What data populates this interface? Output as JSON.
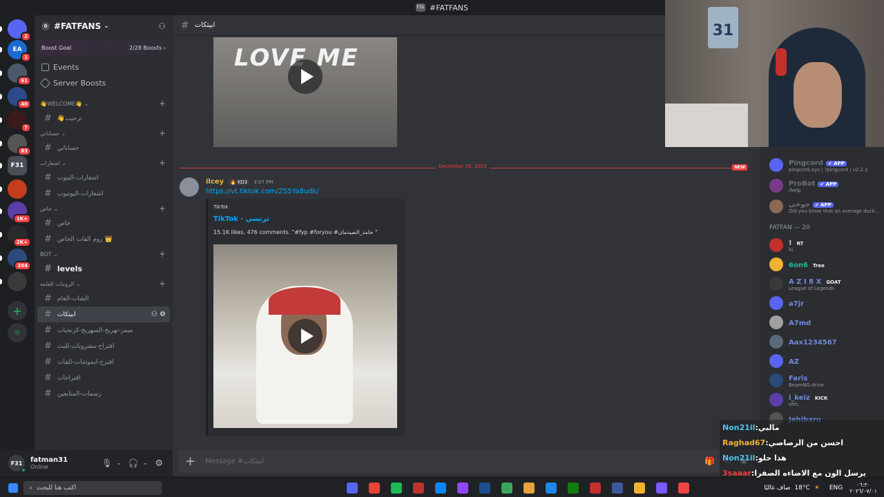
{
  "window": {
    "title": "#FATFANS",
    "server_icon": "F31"
  },
  "guilds": [
    {
      "label": "",
      "badge": "2",
      "color": "#5865f2"
    },
    {
      "label": "EA",
      "badge": "1",
      "color": "#1b6ad0"
    },
    {
      "label": "",
      "badge": "61",
      "color": "#4a5a6a"
    },
    {
      "label": "",
      "badge": "40",
      "color": "#2d4a8a"
    },
    {
      "label": "",
      "badge": "7",
      "color": "#3a1a1a"
    },
    {
      "label": "",
      "badge": "83",
      "color": "#555"
    },
    {
      "label": "F31",
      "badge": "",
      "color": "#4a4d55"
    },
    {
      "label": "",
      "badge": "",
      "color": "#c43d1c"
    },
    {
      "label": "",
      "badge": "1K+",
      "color": "#5b3ea8"
    },
    {
      "label": "",
      "badge": "2K+",
      "color": "#2a2a2a"
    },
    {
      "label": "",
      "badge": "204",
      "color": "#2b4a7a"
    },
    {
      "label": "",
      "badge": "",
      "color": "#3a3a3a"
    }
  ],
  "server": {
    "name": "#FATFANS",
    "boost_goal": "Boost Goal",
    "boost_count": "2/28 Boosts",
    "nav": [
      "Events",
      "Server Boosts"
    ],
    "categories": [
      {
        "name": "👋WELCOME👋",
        "channels": [
          {
            "name": "👋ترحيب",
            "active": false
          }
        ]
      },
      {
        "name": "حساباتي",
        "channels": [
          {
            "name": "حساباتي",
            "active": false
          }
        ]
      },
      {
        "name": "اشعارات",
        "channels": [
          {
            "name": "اشعارات-اليتوب",
            "active": false
          },
          {
            "name": "اشعارات-اليوتيوب",
            "active": false
          }
        ]
      },
      {
        "name": "خاص",
        "channels": [
          {
            "name": "خاص",
            "active": false
          },
          {
            "name": "روم الفات الخاص 👑",
            "active": false
          }
        ]
      },
      {
        "name": "BOT",
        "channels": [
          {
            "name": "levels",
            "active": false
          }
        ]
      },
      {
        "name": "الرومات العامه",
        "channels": [
          {
            "name": "الشات-العام",
            "active": false
          },
          {
            "name": "ابيتكات",
            "active": true
          },
          {
            "name": "ميمز-تهريج-السهريج-كرنجيات",
            "active": false
          },
          {
            "name": "اقتراح-مشروبات-للبث",
            "active": false
          },
          {
            "name": "اقترح-ايموشات-للفات",
            "active": false
          },
          {
            "name": "اقتراحات",
            "active": false
          },
          {
            "name": "رسمات-المتابعين",
            "active": false
          }
        ]
      }
    ]
  },
  "user": {
    "name": "fatman31",
    "status": "Online"
  },
  "channel": {
    "name": "ابيتكات",
    "composer_placeholder": "Message #ابيتكات"
  },
  "divider": {
    "date": "December 30, 2025",
    "new": "NEW"
  },
  "message": {
    "author": "ilcey",
    "tag": "KO3",
    "time": "3:07 PM",
    "link": "https://vt.tiktok.com/ZS5Ya8udk/",
    "embed": {
      "provider": "TikTok",
      "title": "TikTok · ترتسي",
      "description": "15.1K likes, 476 comments. \"#fyp #foryou #حامد_الصيدمان \""
    }
  },
  "top_video_text": "LOVE ME",
  "members": {
    "bots": [
      {
        "name": "Pingcord",
        "tag": "APP",
        "sub": "pingcord.xyz | ?pingcord | v2.2.1",
        "color": "#6b6f7a"
      },
      {
        "name": "ProBot",
        "tag": "APP",
        "sub": "/help",
        "color": "#6b6f7a"
      },
      {
        "name": "جوحي",
        "tag": "APP",
        "sub": "Did you know that an average duck...",
        "color": "#6b6f7a"
      }
    ],
    "section": "FATFAN — 20",
    "list": [
      {
        "name": "!",
        "tag": "RT",
        "sub": "hi",
        "color": "#dbdee1"
      },
      {
        "name": "6on6",
        "tag": "Tree",
        "sub": "",
        "color": "#1abc9c"
      },
      {
        "name": "A Z I 8 X",
        "tag": "GOAT",
        "sub": "League of Legends",
        "color": "#7289da"
      },
      {
        "name": "a7jr",
        "tag": "",
        "sub": "",
        "color": "#7289da"
      },
      {
        "name": "A7md",
        "tag": "",
        "sub": "",
        "color": "#7289da"
      },
      {
        "name": "Aax1234567",
        "tag": "",
        "sub": "",
        "color": "#7289da"
      },
      {
        "name": "AZ",
        "tag": "",
        "sub": "",
        "color": "#7289da"
      },
      {
        "name": "Faris",
        "tag": "",
        "sub": "BeamNG.drive",
        "color": "#7289da"
      },
      {
        "name": "i_keiz",
        "tag": "KICK",
        "sub": "ohh..",
        "color": "#7289da"
      },
      {
        "name": "Jehibaru",
        "tag": "",
        "sub": "",
        "color": "#7289da"
      }
    ]
  },
  "chat_overlay": [
    {
      "user": "Non21il",
      "text": "مالبي"
    },
    {
      "user": "Raghad67",
      "text": "احسن من الرصاصي"
    },
    {
      "user": "Non21il",
      "text": "هذا حلو"
    },
    {
      "user": "3saaar",
      "text": "يرسل الون مع الاضاءه الصفرا"
    }
  ],
  "taskbar": {
    "date": "٢٠٢٦/٠٧/٠١",
    "time": "٠٦:٣٠",
    "lang": "ENG",
    "weather": "18°C",
    "weather_text": "صاف غالبًا",
    "search_placeholder": "اكتب هنا للبحث"
  }
}
